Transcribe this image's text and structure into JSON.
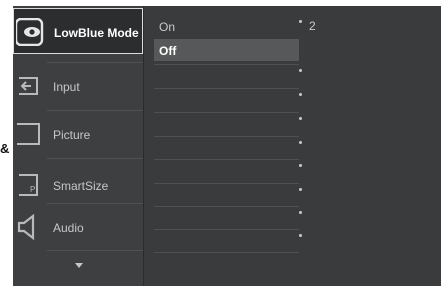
{
  "menu": {
    "items": [
      {
        "label": "LowBlue Mode",
        "icon": "eye-icon",
        "active": true
      },
      {
        "label": "Input",
        "icon": "input-icon",
        "active": false
      },
      {
        "label": "Picture",
        "icon": "picture-icon",
        "active": false
      },
      {
        "label": "SmartSize",
        "icon": "smartsize-icon",
        "active": false
      },
      {
        "label": "Audio",
        "icon": "speaker-icon",
        "active": false
      }
    ],
    "more_icon": "chevron-down-icon"
  },
  "options": {
    "items": [
      {
        "label": "On",
        "selected": false
      },
      {
        "label": "Off",
        "selected": true
      }
    ],
    "sub_value": "2"
  },
  "side_badge": "&",
  "colors": {
    "background": "#3a3b3c",
    "active_border": "#dcdcdc",
    "selected_option": "#575859",
    "text": "#c9cacb"
  }
}
